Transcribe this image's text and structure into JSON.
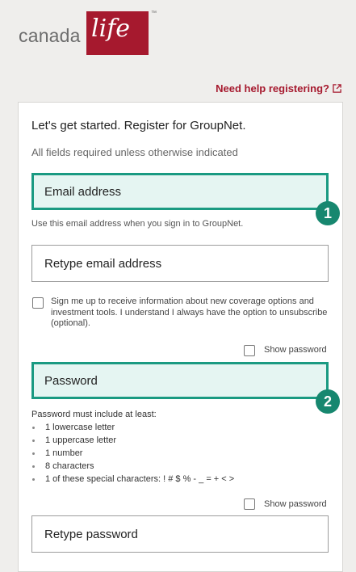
{
  "brand": {
    "word": "canada",
    "life": "life",
    "tm": "™"
  },
  "help_link": {
    "label": "Need help registering?",
    "icon": "external-link-icon"
  },
  "form": {
    "intro": "Let's get started. Register for GroupNet.",
    "required_note": "All fields required unless otherwise indicated",
    "email_placeholder": "Email address",
    "email_hint": "Use this email address when you sign in to GroupNet.",
    "retype_email_placeholder": "Retype email address",
    "consent_text": "Sign me up to receive information about new coverage options and investment tools. I understand I always have the option to unsubscribe (optional).",
    "show_password_label": "Show password",
    "password_placeholder": "Password",
    "password_rules_title": "Password must include at least:",
    "password_rules": [
      "1 lowercase letter",
      "1 uppercase letter",
      "1 number",
      "8 characters",
      "1 of these special characters: ! # $ % - _ = + < >"
    ],
    "show_password_label_2": "Show password",
    "retype_password_placeholder": "Retype password"
  },
  "annotations": {
    "badge_1": "1",
    "badge_2": "2"
  },
  "colors": {
    "brand_red": "#a6192e",
    "highlight_border": "#1a9a82",
    "highlight_fill": "#e5f5f2",
    "badge": "#17876f"
  }
}
